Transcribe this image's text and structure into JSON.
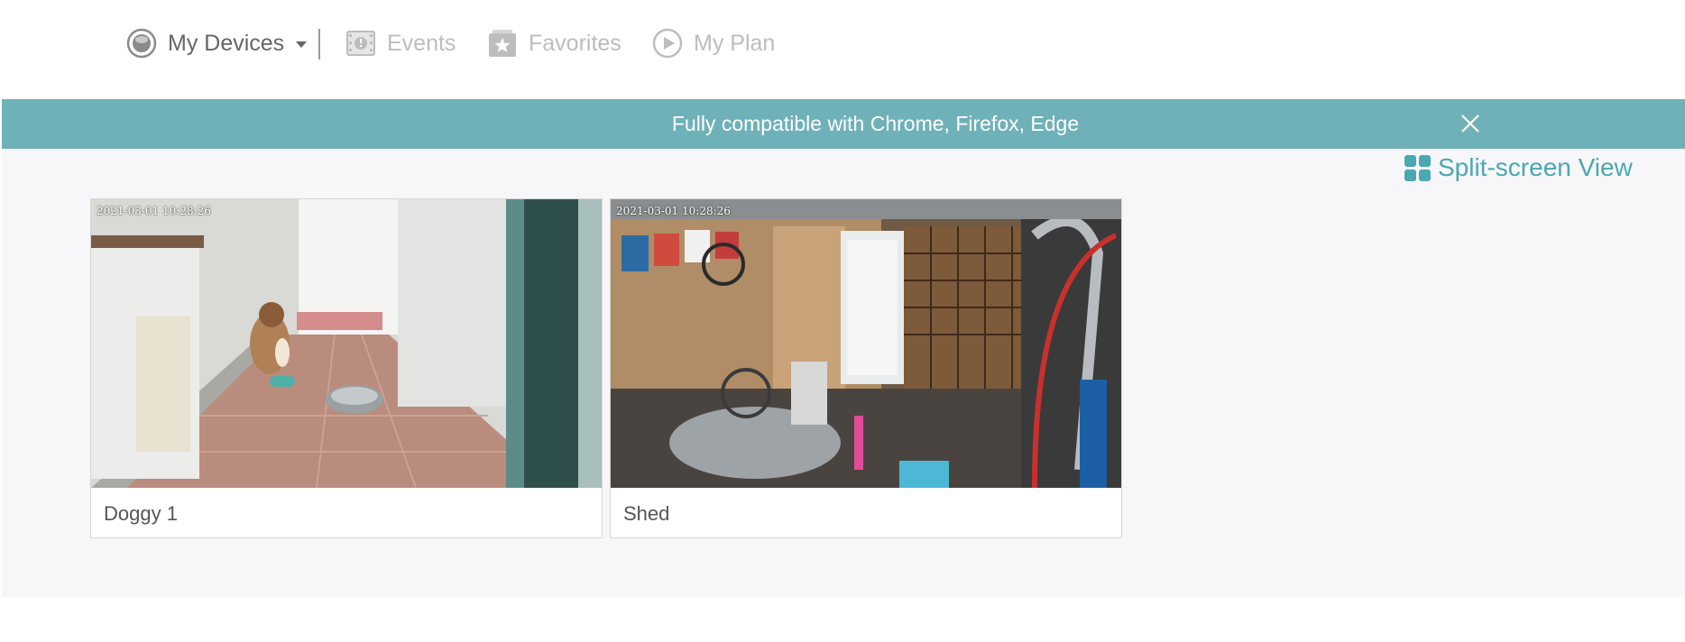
{
  "nav": {
    "my_devices": "My Devices",
    "events": "Events",
    "favorites": "Favorites",
    "my_plan": "My Plan"
  },
  "banner": {
    "text": "Fully compatible with Chrome, Firefox, Edge"
  },
  "view": {
    "split_screen_label": "Split-screen View"
  },
  "cameras": [
    {
      "name": "Doggy 1",
      "timestamp": "2021-03-01 10:28:26"
    },
    {
      "name": "Shed",
      "timestamp": "2021-03-01 10:28:26"
    }
  ],
  "colors": {
    "accent": "#4aa8b1",
    "banner": "#6fb1b8",
    "active_text": "#666666",
    "inactive_text": "#bdbdbd"
  },
  "icons": [
    "device-icon",
    "events-icon",
    "favorites-icon",
    "play-icon",
    "close-icon",
    "grid-icon"
  ]
}
